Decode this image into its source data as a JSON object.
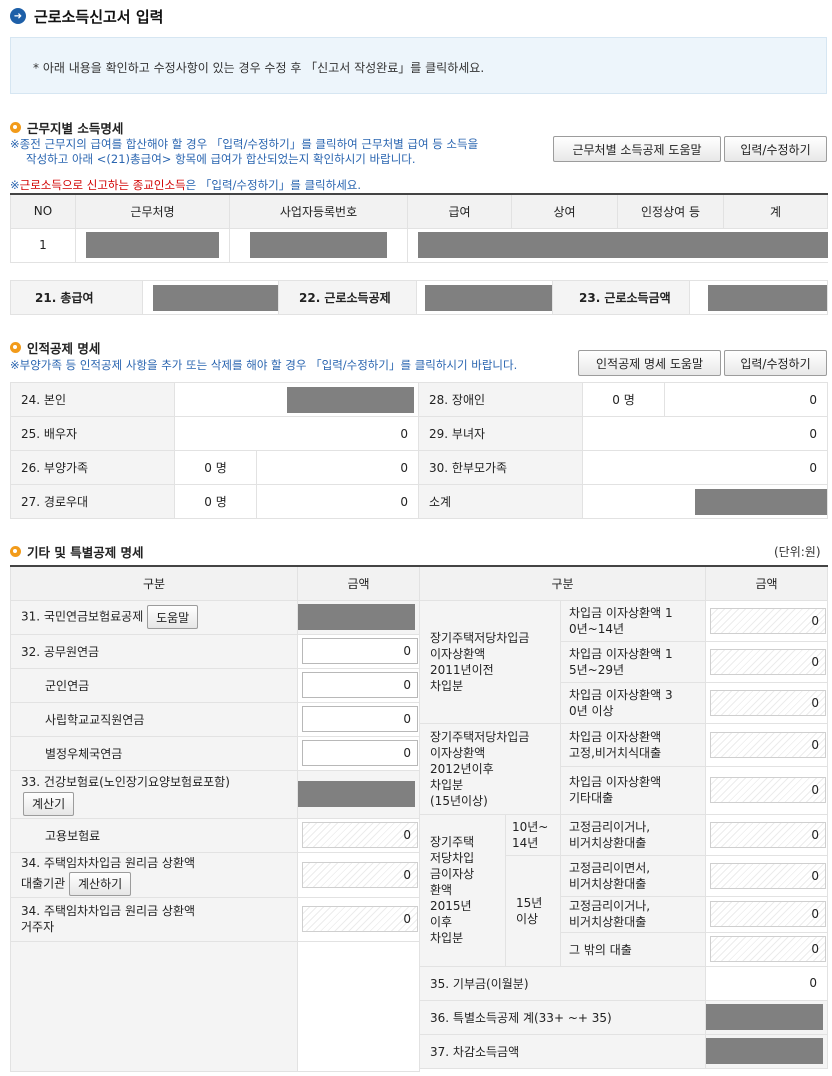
{
  "page": {
    "title": "근로소득신고서 입력",
    "notice": "* 아래 내용을 확인하고 수정사항이 있는 경우 수정 후 「신고서 작성완료」를 클릭하세요."
  },
  "sec1": {
    "title": "근무지별 소득명세",
    "hint1": "※종전 근무지의 급여를 합산해야 할 경우 「입력/수정하기」를 클릭하여 근무처별 급여 등 소득을",
    "hint2": "작성하고 아래 <(21)총급여> 항목에 급여가 합산되었는지 확인하시기 바랍니다.",
    "hint3_prefix": "※",
    "hint3_red": "근로소득으로 신고하는 종교인소득",
    "hint3_suffix": "은 「입력/수정하기」를 클릭하세요.",
    "help_button": "근무처별 소득공제 도움말",
    "edit_button": "입력/수정하기",
    "headers": [
      "NO",
      "근무처명",
      "사업자등록번호",
      "급여",
      "상여",
      "인정상여 등",
      "계"
    ],
    "row_no": "1",
    "sum": {
      "l21": "21. 총급여",
      "l22": "22. 근로소득공제",
      "l23": "23. 근로소득금액"
    }
  },
  "sec2": {
    "title": "인적공제 명세",
    "hint": "※부양가족 등 인적공제 사항을 추가 또는 삭제를 해야 할 경우 「입력/수정하기」를 클릭하시기 바랍니다.",
    "help_button": "인적공제 명세 도움말",
    "edit_button": "입력/수정하기",
    "r24": "24. 본인",
    "r25": "25. 배우자",
    "r25v": "0",
    "r26": "26. 부양가족",
    "r26c": "0  명",
    "r26v": "0",
    "r27": "27. 경로우대",
    "r27c": "0  명",
    "r27v": "0",
    "r28": "28. 장애인",
    "r28c": "0  명",
    "r28v": "0",
    "r29": "29. 부녀자",
    "r29v": "0",
    "r30": "30. 한부모가족",
    "r30v": "0",
    "r_sub": "소계"
  },
  "sec3": {
    "title": "기타 및 특별공제 명세",
    "unit": "(단위:원)",
    "h_gubun": "구분",
    "h_amount": "금액",
    "r31": "31. 국민연금보험료공제",
    "r31btn": "도움말",
    "r32": "32. 공무원연금",
    "r32v": "0",
    "r32a": "군인연금",
    "r32av": "0",
    "r32b": "사립학교교직원연금",
    "r32bv": "0",
    "r32c": "별정우체국연금",
    "r32cv": "0",
    "r33": "33. 건강보험료(노인장기요양보험료포함)",
    "r33btn": "계산기",
    "r33a": "고용보험료",
    "r33av": "0",
    "r34a": "34. 주택임차차입금 원리금 상환액",
    "r34a2": "대출기관",
    "r34abtn": "계산하기",
    "r34av": "0",
    "r34b": "34. 주택임차차입금 원리금 상환액",
    "r34b2": "거주자",
    "r34bv": "0",
    "g2011": [
      "장기주택저당차입금",
      "이자상환액",
      "2011년이전",
      "차입분"
    ],
    "s2011": [
      [
        "차입금 이자상환액 1",
        "0년~14년"
      ],
      [
        "차입금 이자상환액 1",
        "5년~29년"
      ],
      [
        "차입금 이자상환액 3",
        "0년 이상"
      ]
    ],
    "g2012": [
      "장기주택저당차입금",
      "이자상환액",
      "2012년이후",
      "차입분",
      "(15년이상)"
    ],
    "s2012": [
      [
        "차입금 이자상환액",
        "고정,비거치식대출"
      ],
      [
        "차입금 이자상환액",
        "기타대출"
      ]
    ],
    "g2015": [
      "장기주택",
      "저당차입",
      "금이자상",
      "환액",
      "2015년",
      "이후",
      "차입분"
    ],
    "p10": [
      "10년~",
      "14년"
    ],
    "p15": [
      "15년",
      "이상"
    ],
    "s2015": [
      [
        "고정금리이거나,",
        "비거치상환대출"
      ],
      [
        "고정금리이면서,",
        "비거치상환대출"
      ],
      [
        "고정금리이거나,",
        "비거치상환대출"
      ],
      [
        "그 밖의 대출",
        ""
      ]
    ],
    "zero": "0",
    "r35": "35. 기부금(이월분)",
    "r35v": "0",
    "r36": "36. 특별소득공제 계(33+ ~+ 35)",
    "r37": "37. 차감소득금액"
  }
}
